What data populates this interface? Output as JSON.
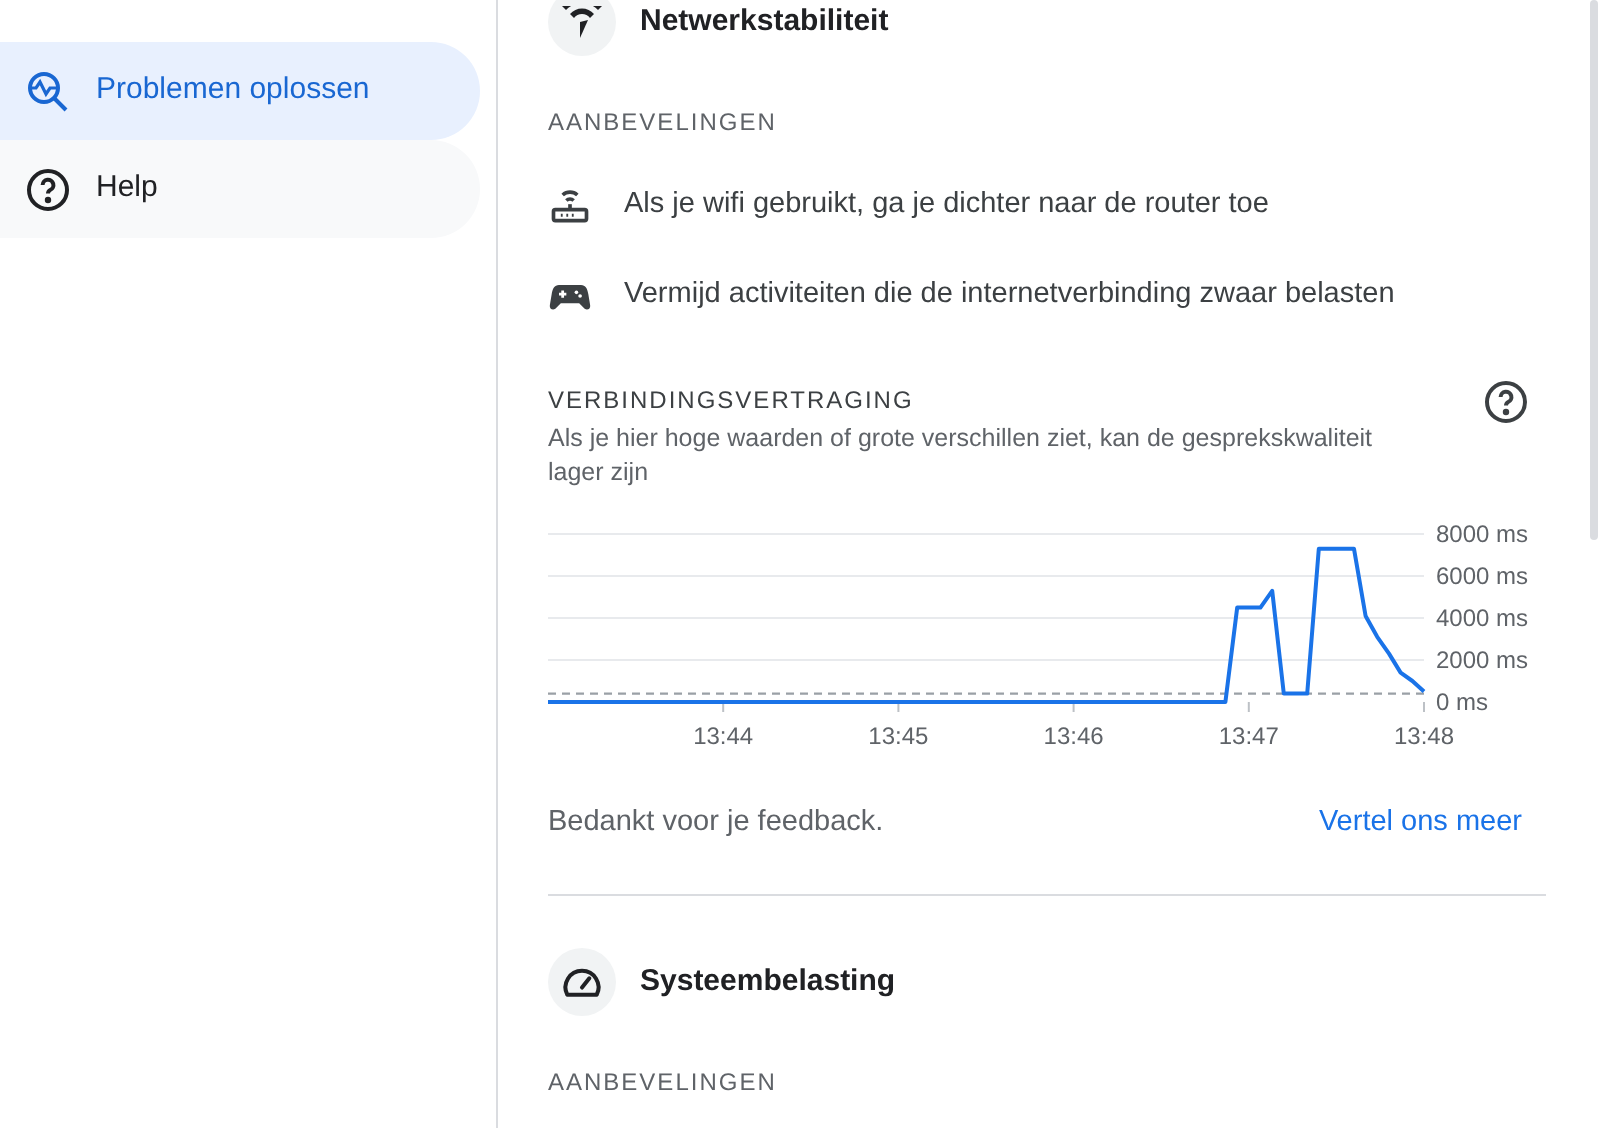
{
  "sidebar": {
    "items": [
      {
        "label": "Problemen oplossen",
        "selected": true
      },
      {
        "label": "Help",
        "selected": false
      }
    ]
  },
  "sections": [
    {
      "title": "Netwerkstabiliteit",
      "kind": "network",
      "recommendations_heading": "AANBEVELINGEN",
      "recommendations": [
        {
          "kind": "router",
          "text": "Als je wifi gebruikt, ga je dichter naar de router toe"
        },
        {
          "kind": "gamepad",
          "text": "Vermijd activiteiten die de internetverbinding zwaar belasten"
        }
      ],
      "latency": {
        "heading": "VERBINDINGSVERTRAGING",
        "description": "Als je hier hoge waarden of grote verschillen ziet, kan de gesprekskwaliteit lager zijn",
        "chart_data": {
          "type": "line",
          "grid": true,
          "categories": [
            null,
            null,
            null,
            null,
            null,
            null,
            null,
            null,
            null,
            null,
            null,
            null,
            null,
            null,
            null,
            "13:44",
            null,
            null,
            null,
            null,
            null,
            null,
            null,
            null,
            null,
            null,
            null,
            null,
            null,
            null,
            "13:45",
            null,
            null,
            null,
            null,
            null,
            null,
            null,
            null,
            null,
            null,
            null,
            null,
            null,
            null,
            "13:46",
            null,
            null,
            null,
            null,
            null,
            null,
            null,
            null,
            null,
            null,
            null,
            null,
            null,
            null,
            "13:47",
            null,
            null,
            null,
            null,
            null,
            null,
            null,
            null,
            null,
            null,
            null,
            null,
            null,
            null,
            "13:48"
          ],
          "series": [
            {
              "color": "#1a73e8",
              "values": [
                0,
                0,
                0,
                0,
                0,
                0,
                0,
                0,
                0,
                0,
                0,
                0,
                0,
                0,
                0,
                0,
                0,
                0,
                0,
                0,
                0,
                0,
                0,
                0,
                0,
                0,
                0,
                0,
                0,
                0,
                0,
                0,
                0,
                0,
                0,
                0,
                0,
                0,
                0,
                0,
                0,
                0,
                0,
                0,
                0,
                0,
                0,
                0,
                0,
                0,
                0,
                0,
                0,
                0,
                0,
                0,
                0,
                0,
                0,
                4500,
                4500,
                4500,
                5300,
                400,
                400,
                400,
                7300,
                7300,
                7300,
                7300,
                4100,
                3100,
                2300,
                1400,
                1000,
                500
              ]
            }
          ],
          "ylim": [
            0,
            8000
          ],
          "yticks": [
            {
              "value": 0,
              "label": "0 ms"
            },
            {
              "value": 2000,
              "label": "2000 ms"
            },
            {
              "value": 4000,
              "label": "4000 ms"
            },
            {
              "value": 6000,
              "label": "6000 ms"
            },
            {
              "value": 8000,
              "label": "8000 ms"
            }
          ],
          "ref_lines": [
            {
              "axis": "y",
              "value": 400
            }
          ]
        }
      },
      "feedback": {
        "text": "Bedankt voor je feedback.",
        "link": "Vertel ons meer"
      }
    },
    {
      "title": "Systeembelasting",
      "kind": "gauge",
      "recommendations_heading": "AANBEVELINGEN"
    }
  ]
}
